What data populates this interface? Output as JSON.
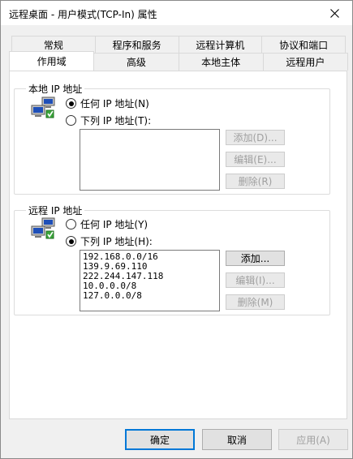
{
  "window": {
    "title": "远程桌面 - 用户模式(TCP-In) 属性",
    "close_glyph": "✕"
  },
  "tabs": {
    "back_row": [
      {
        "label": "常规"
      },
      {
        "label": "程序和服务"
      },
      {
        "label": "远程计算机"
      },
      {
        "label": "协议和端口"
      }
    ],
    "front_row": [
      {
        "label": "作用域",
        "active": true
      },
      {
        "label": "高级"
      },
      {
        "label": "本地主体"
      },
      {
        "label": "远程用户"
      }
    ]
  },
  "local": {
    "title": "本地 IP 地址",
    "option_any": "任何 IP 地址(N)",
    "option_list": "下列 IP 地址(T):",
    "selected": "any",
    "items": [],
    "add_label": "添加(D)...",
    "edit_label": "编辑(E)...",
    "remove_label": "删除(R)"
  },
  "remote": {
    "title": "远程 IP 地址",
    "option_any": "任何 IP 地址(Y)",
    "option_list": "下列 IP 地址(H):",
    "selected": "list",
    "items": [
      "192.168.0.0/16",
      "139.9.69.110",
      "222.244.147.118",
      "10.0.0.0/8",
      "127.0.0.0/8"
    ],
    "add_label": "添加...",
    "edit_label": "编辑(I)...",
    "remove_label": "删除(M)"
  },
  "footer": {
    "ok_label": "确定",
    "cancel_label": "取消",
    "apply_label": "应用(A)"
  },
  "colors": {
    "accent": "#0078d7",
    "disabled_text": "#a0a0a0"
  }
}
